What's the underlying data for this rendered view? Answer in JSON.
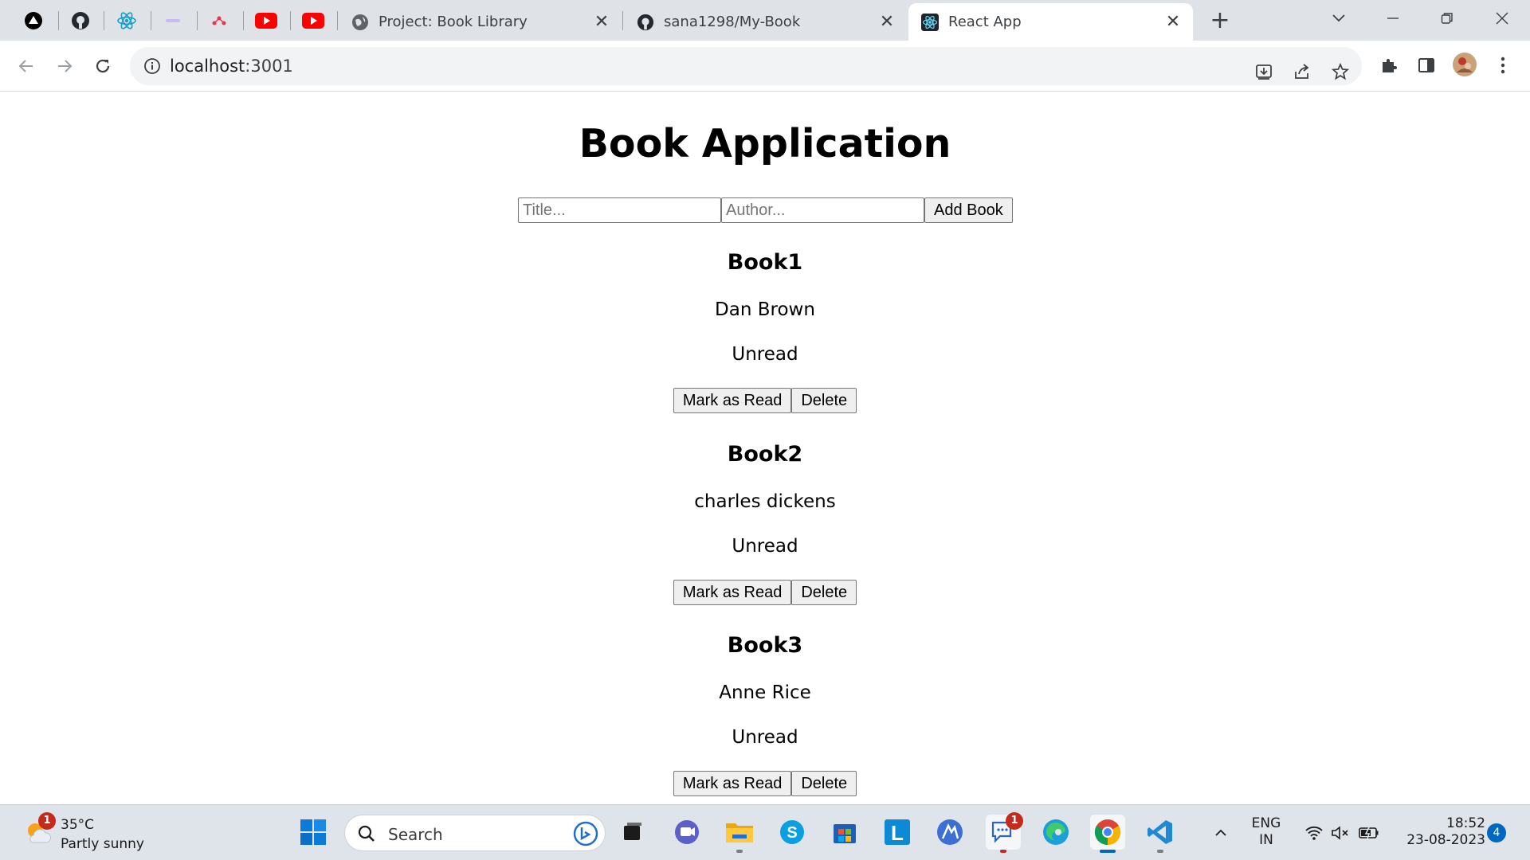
{
  "browser": {
    "tabs": [
      {
        "title": "Project: Book Library",
        "icon": "globe-icon"
      },
      {
        "title": "sana1298/My-Book",
        "icon": "github-icon"
      },
      {
        "title": "React App",
        "icon": "react-icon",
        "active": true
      }
    ],
    "pinned_tabs": [
      "vercel-icon",
      "github-icon",
      "react-icon",
      "stripe-icon",
      "tooljet-icon",
      "youtube-icon",
      "youtube-icon"
    ],
    "url_host": "localhost",
    "url_port": ":3001"
  },
  "page": {
    "title": "Book Application",
    "form": {
      "title_placeholder": "Title...",
      "author_placeholder": "Author...",
      "add_label": "Add Book"
    },
    "books": [
      {
        "title": "Book1",
        "author": "Dan Brown",
        "status": "Unread",
        "mark_label": "Mark as Read",
        "delete_label": "Delete"
      },
      {
        "title": "Book2",
        "author": "charles dickens",
        "status": "Unread",
        "mark_label": "Mark as Read",
        "delete_label": "Delete"
      },
      {
        "title": "Book3",
        "author": "Anne Rice",
        "status": "Unread",
        "mark_label": "Mark as Read",
        "delete_label": "Delete"
      }
    ]
  },
  "taskbar": {
    "weather": {
      "temp": "35°C",
      "condition": "Partly sunny",
      "badge": "1"
    },
    "search_label": "Search",
    "chat_badge": "1",
    "lang_line1": "ENG",
    "lang_line2": "IN",
    "time": "18:52",
    "date": "23-08-2023",
    "notifications": "4"
  },
  "colors": {
    "accent": "#0067c0",
    "youtube": "#ff0000",
    "react": "#149eca"
  }
}
